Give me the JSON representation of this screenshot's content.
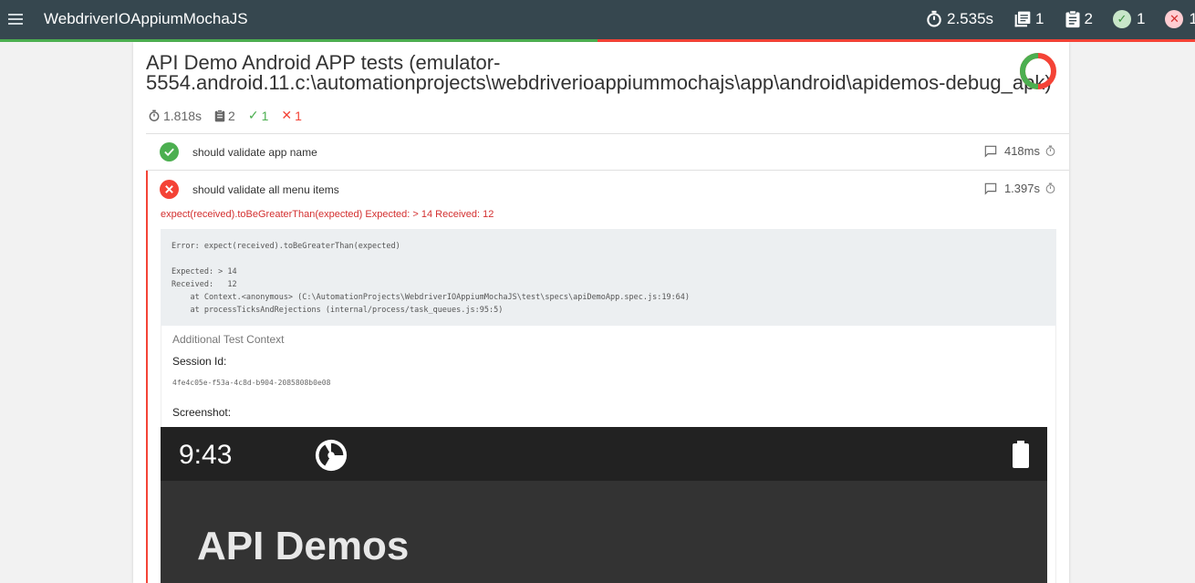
{
  "app": {
    "title": "WebdriverIOAppiumMochaJS"
  },
  "nav_stats": {
    "duration": "2.535s",
    "suites": "1",
    "tests": "2",
    "passed": "1",
    "failed": "1"
  },
  "run_progress": {
    "passed_fraction": 0.5
  },
  "colors": {
    "nav_bg": "#36474f",
    "pass": "#4caf50",
    "fail": "#f44336"
  },
  "suite": {
    "title_line1": "API Demo Android APP tests (emulator-",
    "title_line2": "5554.android.11.c:\\automationprojects\\webdriverioappiummochajs\\app\\android\\apidemos-debug_apk)",
    "duration": "1.818s",
    "tests": "2",
    "passed": "1",
    "failed": "1",
    "pass_fraction": 0.5
  },
  "tests": [
    {
      "name": "should validate app name",
      "duration": "418ms",
      "state": "passed"
    },
    {
      "name": "should validate all menu items",
      "duration": "1.397s",
      "state": "failed",
      "error_message": "expect(received).toBeGreaterThan(expected) Expected: > 14 Received: 12",
      "stack_lines": [
        "Error: expect(received).toBeGreaterThan(expected)",
        "",
        "Expected: > 14",
        "Received:   12",
        "    at Context.<anonymous> (C:\\AutomationProjects\\WebdriverIOAppiumMochaJS\\test\\specs\\apiDemoApp.spec.js:19:64)",
        "    at processTicksAndRejections (internal/process/task_queues.js:95:5)"
      ]
    }
  ],
  "context": {
    "title": "Additional Test Context",
    "session_label": "Session Id:",
    "session_id": "4fe4c05e-f53a-4c8d-b904-2085808b0e08",
    "screenshot_label": "Screenshot:"
  },
  "screenshot": {
    "time": "9:43",
    "app_title": "API Demos"
  }
}
